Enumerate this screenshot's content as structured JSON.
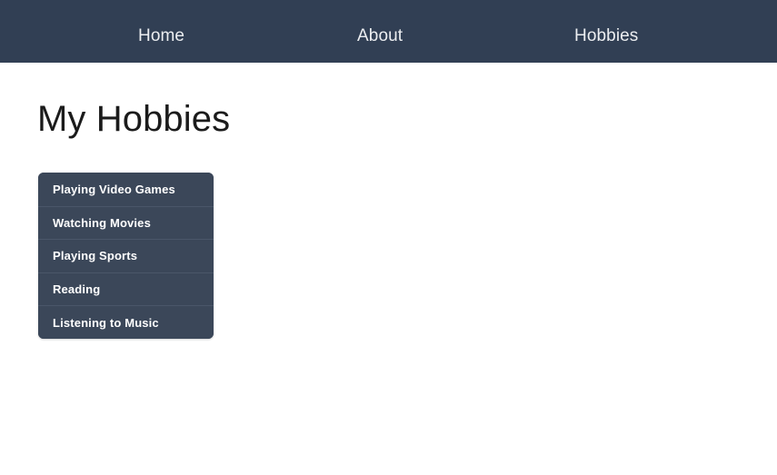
{
  "navbar": {
    "background_color": "#313F54",
    "link_color": "#eceef1",
    "links": [
      {
        "label": "Home",
        "name": "nav-link-home"
      },
      {
        "label": "About",
        "name": "nav-link-about"
      },
      {
        "label": "Hobbies",
        "name": "nav-link-hobbies"
      }
    ]
  },
  "main": {
    "title": "My Hobbies",
    "title_color": "#1b1b1b",
    "background_color": "#ffffff",
    "hobby_list": {
      "item_background_color": "#3b4759",
      "item_text_color": "#ffffff",
      "separator_color": "#4a5669",
      "items": [
        {
          "label": "Playing Video Games"
        },
        {
          "label": "Watching Movies"
        },
        {
          "label": "Playing Sports"
        },
        {
          "label": "Reading"
        },
        {
          "label": "Listening to Music"
        }
      ]
    }
  }
}
